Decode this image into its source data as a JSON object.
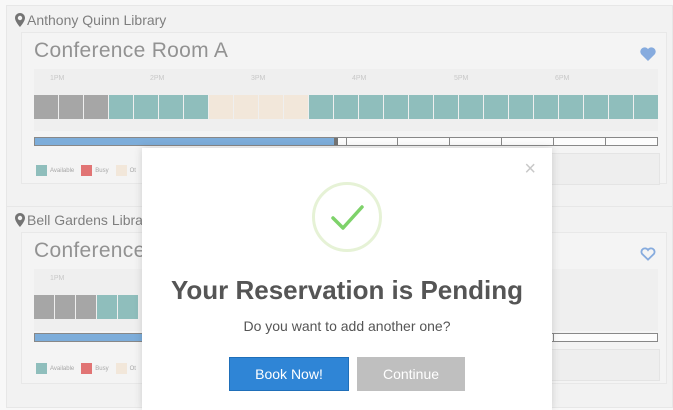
{
  "libraries": [
    {
      "name": "Anthony Quinn Library",
      "room": "Conference Room A",
      "hours": [
        "1PM",
        "2PM",
        "3PM",
        "4PM",
        "5PM",
        "6PM"
      ]
    },
    {
      "name": "Bell Gardens Libra",
      "room": "Conference",
      "hours": [
        "1PM"
      ]
    }
  ],
  "legend": {
    "available": "Available",
    "busy": "Busy",
    "other": "Ot"
  },
  "colors": {
    "available": "#3f8f8c",
    "busy": "#cc1111",
    "other": "#e8d6bf",
    "past": "#666666",
    "accent": "#2f85d6",
    "check": "#7ed26a"
  },
  "modal": {
    "close": "×",
    "title": "Your Reservation is Pending",
    "text": "Do you want to add another one?",
    "primary": "Book Now!",
    "secondary": "Continue"
  },
  "icons": {
    "close": "close-icon",
    "check": "checkmark-icon",
    "pin": "map-pin-icon",
    "heart": "heart-icon"
  }
}
